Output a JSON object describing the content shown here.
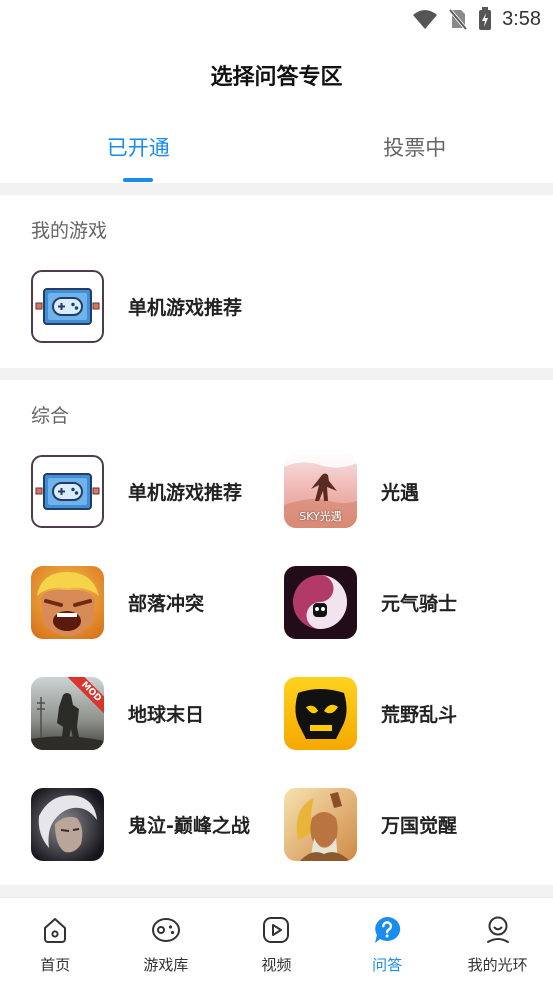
{
  "status_bar": {
    "time": "3:58",
    "icons": [
      "wifi-icon",
      "no-sim-icon",
      "battery-charging-icon"
    ]
  },
  "header": {
    "title": "选择问答专区"
  },
  "tabs": [
    {
      "label": "已开通",
      "active": true
    },
    {
      "label": "投票中",
      "active": false
    }
  ],
  "my_games": {
    "title": "我的游戏",
    "items": [
      {
        "name": "单机游戏推荐",
        "icon": "single-player-games-icon"
      }
    ]
  },
  "general": {
    "title": "综合",
    "items": [
      {
        "name": "单机游戏推荐",
        "icon": "single-player-games-icon"
      },
      {
        "name": "光遇",
        "icon": "sky-game-icon",
        "icon_text": "SKY光遇"
      },
      {
        "name": "部落冲突",
        "icon": "clash-of-clans-icon"
      },
      {
        "name": "元气骑士",
        "icon": "soul-knight-icon"
      },
      {
        "name": "地球末日",
        "icon": "last-day-on-earth-icon",
        "badge": "MOD"
      },
      {
        "name": "荒野乱斗",
        "icon": "brawl-stars-icon"
      },
      {
        "name": "鬼泣-巅峰之战",
        "icon": "devil-may-cry-icon"
      },
      {
        "name": "万国觉醒",
        "icon": "rise-of-kingdoms-icon"
      }
    ]
  },
  "bottom_nav": [
    {
      "label": "首页",
      "icon": "home-icon",
      "active": false
    },
    {
      "label": "游戏库",
      "icon": "game-library-icon",
      "active": false
    },
    {
      "label": "视频",
      "icon": "video-icon",
      "active": false
    },
    {
      "label": "问答",
      "icon": "qa-icon",
      "active": true
    },
    {
      "label": "我的光环",
      "icon": "profile-icon",
      "active": false
    }
  ],
  "colors": {
    "accent": "#1a8cf0",
    "text": "#222222",
    "muted": "#666666",
    "separator": "#f2f2f3"
  }
}
